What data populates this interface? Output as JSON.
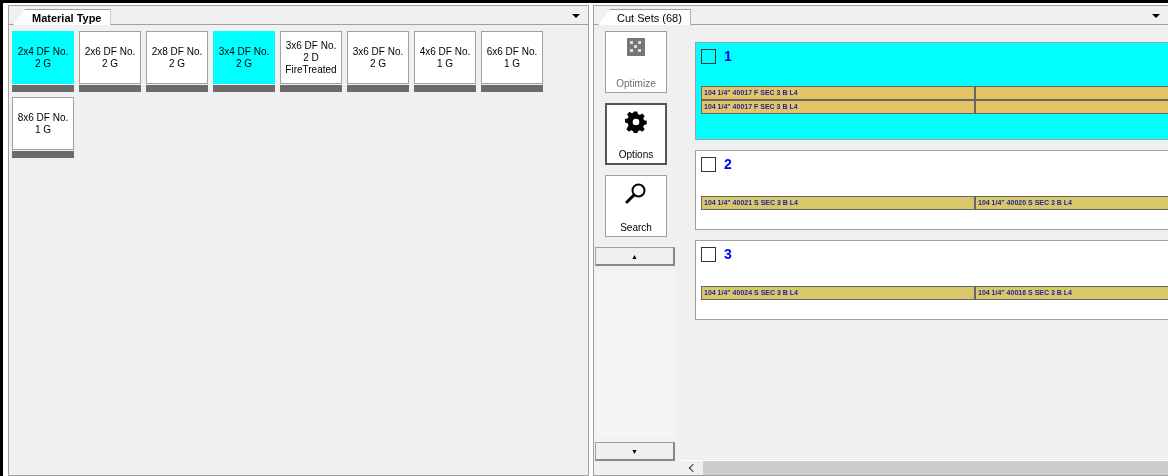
{
  "material_panel": {
    "tab": {
      "label": "Material Type",
      "selected": true
    },
    "materials": [
      {
        "label": "2x4 DF No.\n2 G",
        "selected": true
      },
      {
        "label": "2x6 DF No.\n2 G",
        "selected": false
      },
      {
        "label": "2x8 DF No.\n2 G",
        "selected": false
      },
      {
        "label": "3x4 DF No.\n2 G",
        "selected": true
      },
      {
        "label": "3x6 DF No.\n2 D\nFireTreated",
        "selected": false
      },
      {
        "label": "3x6 DF No.\n2 G",
        "selected": false
      },
      {
        "label": "4x6 DF No.\n1 G",
        "selected": false
      },
      {
        "label": "6x6 DF No.\n1 G",
        "selected": false
      },
      {
        "label": "8x6 DF No.\n1 G",
        "selected": false
      }
    ]
  },
  "cut_sets_panel": {
    "tab": {
      "label": "Cut Sets (68)",
      "selected": true
    },
    "tools": [
      {
        "kind": "optimize",
        "label": "Optimize",
        "disabled": true,
        "selected": false
      },
      {
        "kind": "options",
        "label": "Options",
        "disabled": false,
        "selected": true
      },
      {
        "kind": "search",
        "label": "Search",
        "disabled": false,
        "selected": false
      }
    ],
    "scroll_up": "▲",
    "scroll_down": "▼",
    "cut_sets": [
      {
        "number": "1",
        "checked": false,
        "selected": true,
        "rows": [
          {
            "pieces": [
              "104 1/4\" 40017 F SEC 3 B L4"
            ]
          },
          {
            "pieces": [
              "104 1/4\" 40017 F SEC 3 B L4"
            ]
          }
        ]
      },
      {
        "number": "2",
        "checked": false,
        "selected": false,
        "rows": [
          {
            "pieces": [
              "104 1/4\" 40021 S SEC 3 B L4",
              "104 1/4\" 40020 S SEC 3 B L4"
            ]
          }
        ]
      },
      {
        "number": "3",
        "checked": false,
        "selected": false,
        "rows": [
          {
            "pieces": [
              "104 1/4\" 40024 S SEC 3 B L4",
              "104 1/4\" 40016 S SEC 3 B L4"
            ]
          }
        ]
      }
    ]
  }
}
